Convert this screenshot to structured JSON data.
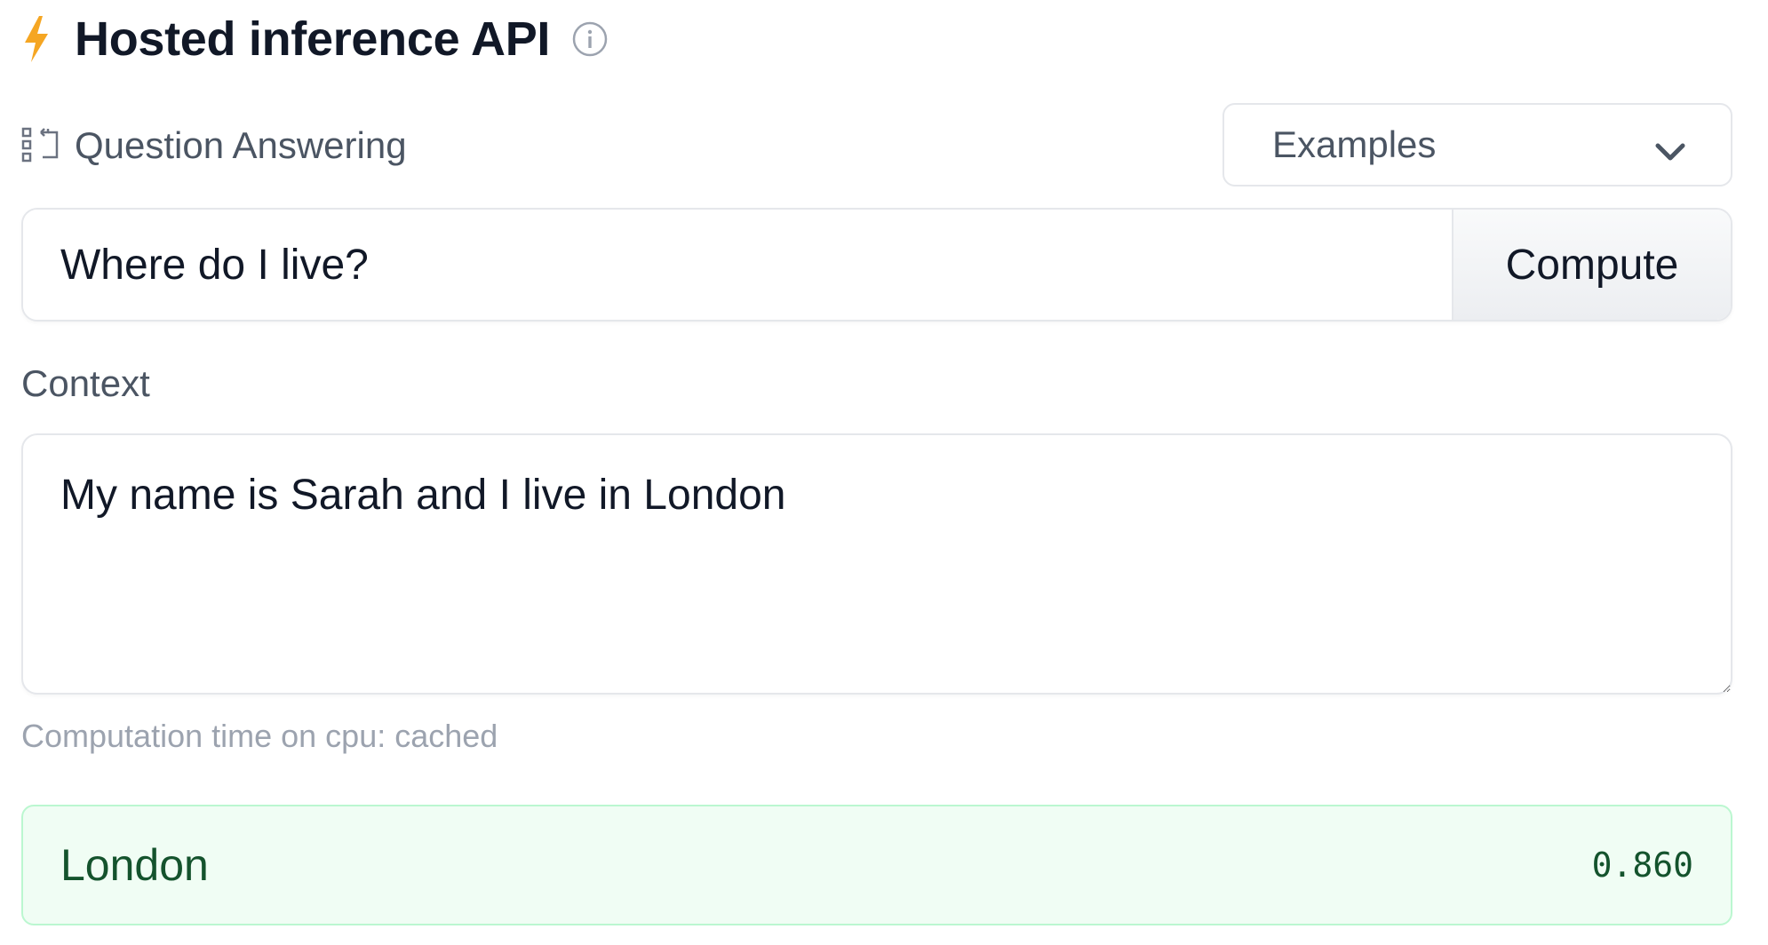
{
  "header": {
    "title": "Hosted inference API",
    "bolt_icon": "lightning-bolt-icon",
    "info_icon": "info-icon"
  },
  "task": {
    "label": "Question Answering",
    "icon": "question-answering-icon"
  },
  "examples": {
    "label": "Examples",
    "icon": "chevron-down-icon"
  },
  "question": {
    "value": "Where do I live?"
  },
  "compute": {
    "label": "Compute"
  },
  "context": {
    "label": "Context",
    "value": "My name is Sarah and I live in London"
  },
  "status": {
    "computation_time": "Computation time on cpu: cached"
  },
  "result": {
    "answer": "London",
    "score": "0.860"
  },
  "colors": {
    "accent": "#f5a623",
    "result_bg": "#f0fdf4",
    "result_border": "#bbf7d0"
  }
}
